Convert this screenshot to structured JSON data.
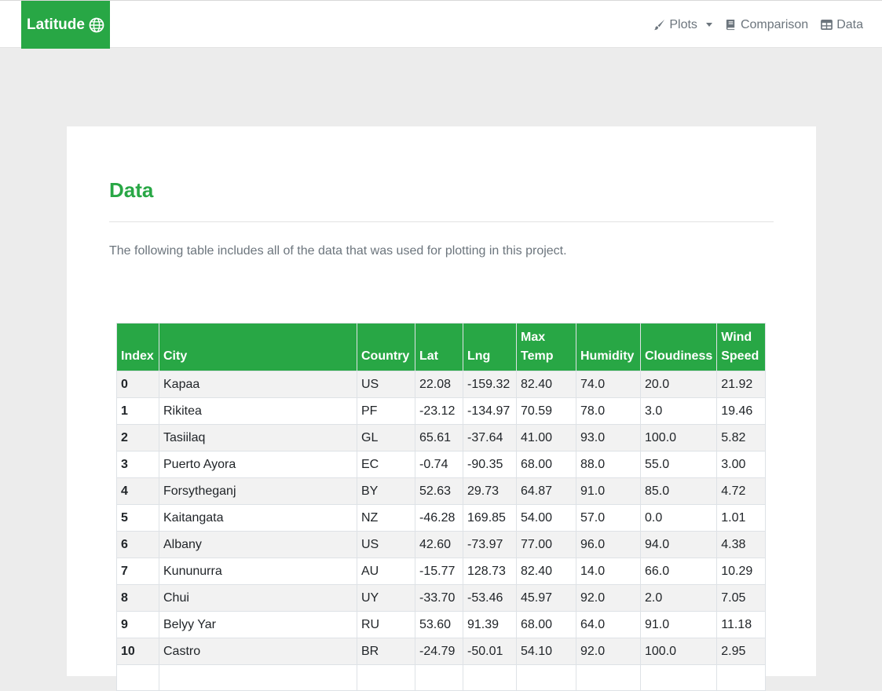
{
  "navbar": {
    "brand": "Latitude",
    "brand_icon": "globe-icon",
    "links": [
      {
        "label": "Plots",
        "icon": "paintbrush-icon",
        "dropdown": true
      },
      {
        "label": "Comparison",
        "icon": "book-icon"
      },
      {
        "label": "Data",
        "icon": "table-icon"
      }
    ]
  },
  "colors": {
    "accent": "#28a745",
    "muted": "#6c757d",
    "background": "#ececec"
  },
  "main": {
    "title": "Data",
    "intro": "The following table includes all of the data that was used for plotting in this project."
  },
  "table": {
    "headers": [
      "Index",
      "City",
      "Country",
      "Lat",
      "Lng",
      "Max\nTemp",
      "Humidity",
      "Cloudiness",
      "Wind\nSpeed"
    ],
    "rows": [
      [
        "0",
        "Kapaa",
        "US",
        "22.08",
        "-159.32",
        "82.40",
        "74.0",
        "20.0",
        "21.92"
      ],
      [
        "1",
        "Rikitea",
        "PF",
        "-23.12",
        "-134.97",
        "70.59",
        "78.0",
        "3.0",
        "19.46"
      ],
      [
        "2",
        "Tasiilaq",
        "GL",
        "65.61",
        "-37.64",
        "41.00",
        "93.0",
        "100.0",
        "5.82"
      ],
      [
        "3",
        "Puerto Ayora",
        "EC",
        "-0.74",
        "-90.35",
        "68.00",
        "88.0",
        "55.0",
        "3.00"
      ],
      [
        "4",
        "Forsytheganj",
        "BY",
        "52.63",
        "29.73",
        "64.87",
        "91.0",
        "85.0",
        "4.72"
      ],
      [
        "5",
        "Kaitangata",
        "NZ",
        "-46.28",
        "169.85",
        "54.00",
        "57.0",
        "0.0",
        "1.01"
      ],
      [
        "6",
        "Albany",
        "US",
        "42.60",
        "-73.97",
        "77.00",
        "96.0",
        "94.0",
        "4.38"
      ],
      [
        "7",
        "Kununurra",
        "AU",
        "-15.77",
        "128.73",
        "82.40",
        "14.0",
        "66.0",
        "10.29"
      ],
      [
        "8",
        "Chui",
        "UY",
        "-33.70",
        "-53.46",
        "45.97",
        "92.0",
        "2.0",
        "7.05"
      ],
      [
        "9",
        "Belyy Yar",
        "RU",
        "53.60",
        "91.39",
        "68.00",
        "64.0",
        "91.0",
        "11.18"
      ],
      [
        "10",
        "Castro",
        "BR",
        "-24.79",
        "-50.01",
        "54.10",
        "92.0",
        "100.0",
        "2.95"
      ],
      [
        "",
        "",
        "",
        "",
        "",
        "",
        "",
        "",
        ""
      ]
    ]
  }
}
